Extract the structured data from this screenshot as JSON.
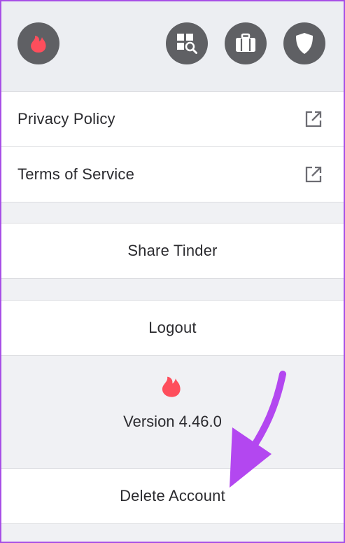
{
  "header": {
    "buttons": [
      {
        "name": "tinder-flame-button",
        "icon": "flame-icon"
      },
      {
        "name": "discovery-search-button",
        "icon": "grid-search-icon"
      },
      {
        "name": "passport-button",
        "icon": "suitcase-icon"
      },
      {
        "name": "safety-button",
        "icon": "shield-icon"
      }
    ]
  },
  "links": {
    "privacy_policy": "Privacy Policy",
    "terms_of_service": "Terms of Service"
  },
  "actions": {
    "share": "Share Tinder",
    "logout": "Logout",
    "delete_account": "Delete Account"
  },
  "app": {
    "version": "Version 4.46.0"
  },
  "colors": {
    "brand": "#fe4e5c",
    "annotation_arrow": "#b347f0",
    "icon_button_bg": "#5f6064",
    "screenshot_border": "#a74fe6"
  },
  "annotation": {
    "arrow_icon": "arrow-pointer-icon"
  }
}
